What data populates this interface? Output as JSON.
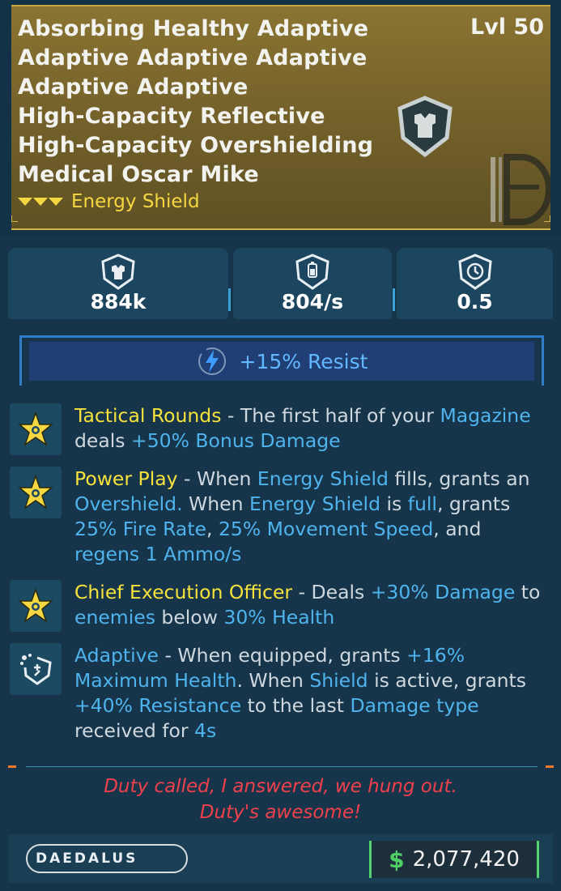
{
  "item": {
    "name_lines": [
      "Absorbing Healthy Adaptive",
      "Adaptive Adaptive Adaptive",
      "Adaptive Adaptive",
      "High-Capacity Reflective",
      "High-Capacity Overshielding",
      "Medical Oscar Mike"
    ],
    "level": "Lvl 50",
    "type": "Energy Shield"
  },
  "stats": [
    {
      "icon": "shield-capacity-icon",
      "value": "884k"
    },
    {
      "icon": "recharge-rate-icon",
      "value": "804/s"
    },
    {
      "icon": "recharge-delay-icon",
      "value": "0.5"
    }
  ],
  "resist": {
    "icon": "lightning-icon",
    "text": "+15% Resist"
  },
  "perks": [
    {
      "icon": "star-icon",
      "title": "Tactical Rounds",
      "segments": [
        {
          "t": " - The first half of your ",
          "c": "g"
        },
        {
          "t": "Magazine",
          "c": "b"
        },
        {
          "t": " deals ",
          "c": "g"
        },
        {
          "t": "+50% Bonus Damage",
          "c": "b"
        }
      ]
    },
    {
      "icon": "star-icon",
      "title": "Power Play",
      "segments": [
        {
          "t": " - When ",
          "c": "g"
        },
        {
          "t": "Energy Shield",
          "c": "b"
        },
        {
          "t": " fills, grants an ",
          "c": "g"
        },
        {
          "t": "Overshield.",
          "c": "b"
        },
        {
          "t": " When ",
          "c": "g"
        },
        {
          "t": "Energy Shield",
          "c": "b"
        },
        {
          "t": " is ",
          "c": "g"
        },
        {
          "t": "full",
          "c": "b"
        },
        {
          "t": ", grants ",
          "c": "g"
        },
        {
          "t": "25% Fire Rate",
          "c": "b"
        },
        {
          "t": ", ",
          "c": "g"
        },
        {
          "t": "25% Movement Speed",
          "c": "b"
        },
        {
          "t": ", and ",
          "c": "g"
        },
        {
          "t": "regens 1 Ammo/s",
          "c": "b"
        }
      ]
    },
    {
      "icon": "star-icon",
      "title": "Chief Execution Officer",
      "segments": [
        {
          "t": " - Deals ",
          "c": "g"
        },
        {
          "t": "+30% Damage",
          "c": "b"
        },
        {
          "t": " to ",
          "c": "g"
        },
        {
          "t": "enemies",
          "c": "b"
        },
        {
          "t": " below ",
          "c": "g"
        },
        {
          "t": "30% Health",
          "c": "b"
        }
      ]
    },
    {
      "icon": "adaptive-shield-icon",
      "title": "Adaptive",
      "title_class": "b",
      "segments": [
        {
          "t": " - When equipped, grants ",
          "c": "g"
        },
        {
          "t": "+16% Maximum Health",
          "c": "b"
        },
        {
          "t": ". When ",
          "c": "g"
        },
        {
          "t": "Shield",
          "c": "b"
        },
        {
          "t": " is active, grants ",
          "c": "g"
        },
        {
          "t": "+40% Resistance",
          "c": "b"
        },
        {
          "t": " to the last ",
          "c": "g"
        },
        {
          "t": "Damage type",
          "c": "b"
        },
        {
          "t": " received for ",
          "c": "g"
        },
        {
          "t": "4s",
          "c": "b"
        }
      ]
    }
  ],
  "flavor": [
    "Duty called, I answered, we hung out.",
    "Duty's awesome!"
  ],
  "footer": {
    "brand": "DAEDALUS",
    "currency_symbol": "$",
    "price": "2,077,420"
  },
  "colors": {
    "rarity": "#f5d742",
    "accent_blue": "#4fb4ee",
    "flavor_red": "#f0404c",
    "money_green": "#4fcf66"
  }
}
